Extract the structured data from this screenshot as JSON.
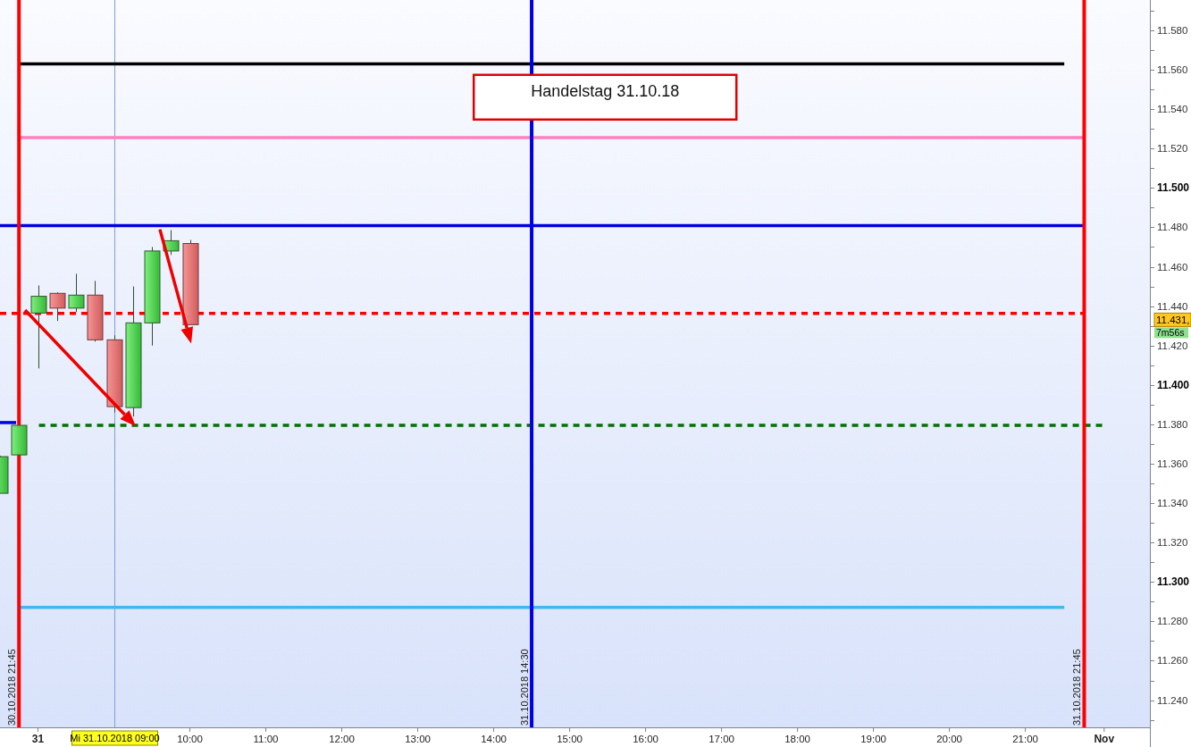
{
  "annotation_box": {
    "text": "Handelstag 31.10.18"
  },
  "time_lines": [
    {
      "label": "30.10.2018 21:45"
    },
    {
      "label": "31.10.2018 14:30"
    },
    {
      "label": "31.10.2018 21:45"
    }
  ],
  "price_axis": {
    "labels": [
      {
        "text": "11.580",
        "bold": false
      },
      {
        "text": "11.560",
        "bold": false
      },
      {
        "text": "11.540",
        "bold": false
      },
      {
        "text": "11.520",
        "bold": false
      },
      {
        "text": "11.500",
        "bold": true
      },
      {
        "text": "11.480",
        "bold": false
      },
      {
        "text": "11.460",
        "bold": false
      },
      {
        "text": "11.440",
        "bold": false
      },
      {
        "text": "11.420",
        "bold": false
      },
      {
        "text": "11.400",
        "bold": true
      },
      {
        "text": "11.380",
        "bold": false
      },
      {
        "text": "11.360",
        "bold": false
      },
      {
        "text": "11.340",
        "bold": false
      },
      {
        "text": "11.320",
        "bold": false
      },
      {
        "text": "11.300",
        "bold": true
      },
      {
        "text": "11.280",
        "bold": false
      },
      {
        "text": "11.260",
        "bold": false
      },
      {
        "text": "11.240",
        "bold": false
      }
    ],
    "price_marker": "11.431,",
    "timer": "7m56s"
  },
  "time_axis": {
    "labels": [
      {
        "text": "31",
        "bold": true
      },
      {
        "text": "10:00",
        "bold": false
      },
      {
        "text": "11:00",
        "bold": false
      },
      {
        "text": "12:00",
        "bold": false
      },
      {
        "text": "13:00",
        "bold": false
      },
      {
        "text": "14:00",
        "bold": false
      },
      {
        "text": "15:00",
        "bold": false
      },
      {
        "text": "16:00",
        "bold": false
      },
      {
        "text": "17:00",
        "bold": false
      },
      {
        "text": "18:00",
        "bold": false
      },
      {
        "text": "19:00",
        "bold": false
      },
      {
        "text": "20:00",
        "bold": false
      },
      {
        "text": "21:00",
        "bold": false
      },
      {
        "text": "Nov",
        "bold": true
      }
    ],
    "cursor_label": "Mi 31.10.2018 09:00"
  }
}
